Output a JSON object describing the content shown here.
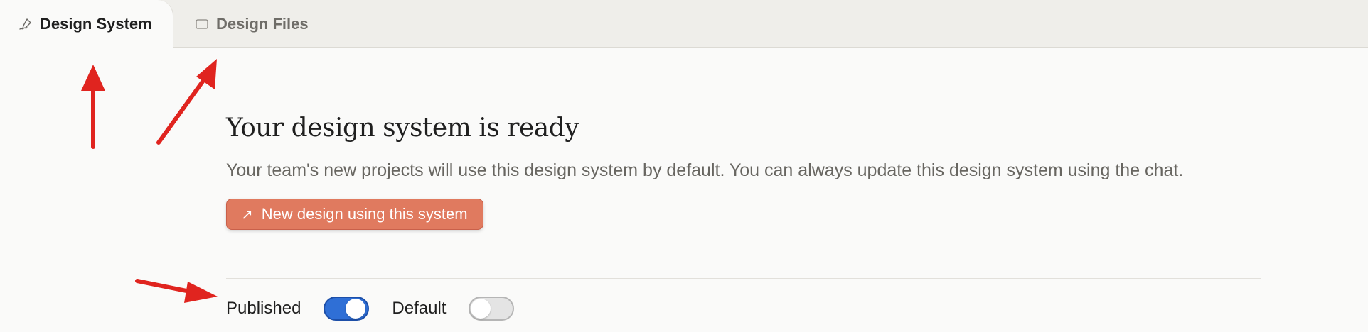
{
  "tabs": [
    {
      "label": "Design System",
      "icon": "signature-icon",
      "active": true
    },
    {
      "label": "Design Files",
      "icon": "folder-icon",
      "active": false
    }
  ],
  "main": {
    "title": "Your design system is ready",
    "description": "Your team's new projects will use this design system by default. You can always update this design system using the chat.",
    "cta_label": "New design using this system",
    "cta_icon": "↗"
  },
  "toggles": {
    "published_label": "Published",
    "published_on": true,
    "default_label": "Default",
    "default_on": false
  },
  "colors": {
    "accent": "#e07a5f",
    "toggle_on": "#2f6fd6",
    "annotation": "#e0241f"
  }
}
